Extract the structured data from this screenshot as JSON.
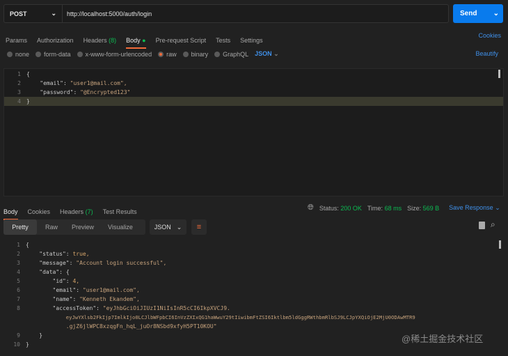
{
  "request": {
    "method": "POST",
    "url": "http://localhost:5000/auth/login",
    "send_label": "Send"
  },
  "req_tabs": {
    "params": "Params",
    "authorization": "Authorization",
    "headers": "Headers",
    "headers_count": "(8)",
    "body": "Body",
    "prerequest": "Pre-request Script",
    "tests": "Tests",
    "settings": "Settings",
    "cookies": "Cookies"
  },
  "body_types": {
    "none": "none",
    "form_data": "form-data",
    "urlencoded": "x-www-form-urlencoded",
    "raw": "raw",
    "binary": "binary",
    "graphql": "GraphQL",
    "format": "JSON",
    "beautify": "Beautify"
  },
  "req_body": [
    {
      "n": "1",
      "t": "{"
    },
    {
      "n": "2",
      "k": "\"email\"",
      "v": "\"user1@mail.com\","
    },
    {
      "n": "3",
      "k": "\"password\"",
      "v": "\"@Encrypted123\""
    },
    {
      "n": "4",
      "t": "}"
    }
  ],
  "resp_tabs": {
    "body": "Body",
    "cookies": "Cookies",
    "headers": "Headers",
    "headers_count": "(7)",
    "tests": "Test Results"
  },
  "status": {
    "status_label": "Status:",
    "status": "200 OK",
    "time_label": "Time:",
    "time": "68 ms",
    "size_label": "Size:",
    "size": "569 B",
    "save": "Save Response"
  },
  "view": {
    "pretty": "Pretty",
    "raw": "Raw",
    "preview": "Preview",
    "visualize": "Visualize",
    "format": "JSON"
  },
  "resp_body": {
    "l1": "{",
    "l2k": "\"status\"",
    "l2v": "true,",
    "l3k": "\"message\"",
    "l3v": "\"Account login successful\",",
    "l4k": "\"data\"",
    "l4v": "{",
    "l5k": "\"id\"",
    "l5v": "4,",
    "l6k": "\"email\"",
    "l6v": "\"user1@mail.com\",",
    "l7k": "\"name\"",
    "l7v": "\"Kenneth Ekandem\",",
    "l8k": "\"accessToken\"",
    "l8v1": "\"eyJhbGciOiJIUzI1NiIsInR5cCI6IkpXVCJ9.",
    "l8v2": "eyJwYXlsb2FkIjp7ImlkIjo0LCJlbWFpbCI6InVzZXIxQG1haWwuY29tIiwibmFtZSI6Iktlbm5ldGggRWthbmRlbSJ9LCJpYXQiOjE2MjU0ODAwMTR9",
    "l8v3": ".gjZ6jlWPC8xzqgFn_hqL_juOr8NSbd9xfyH5PT10KOU\"",
    "l9": "}",
    "l10": "}"
  },
  "watermark": "@稀土掘金技术社区"
}
